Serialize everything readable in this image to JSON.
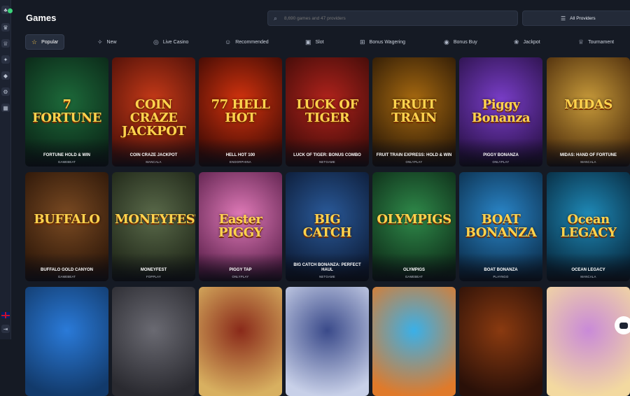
{
  "header": {
    "title": "Games",
    "search_placeholder": "8,690 games and 47 providers",
    "providers_label": "All Providers"
  },
  "tabs": [
    {
      "label": "Popular",
      "icon": "star-icon",
      "glyph": "☆"
    },
    {
      "label": "New",
      "icon": "tag-icon",
      "glyph": "✧"
    },
    {
      "label": "Live Casino",
      "icon": "chip-icon",
      "glyph": "◎"
    },
    {
      "label": "Recommended",
      "icon": "thumbs-up-icon",
      "glyph": "☺"
    },
    {
      "label": "Slot",
      "icon": "slot-machine-icon",
      "glyph": "▣"
    },
    {
      "label": "Bonus Wagering",
      "icon": "gift-icon",
      "glyph": "⊞"
    },
    {
      "label": "Bonus Buy",
      "icon": "coin-icon",
      "glyph": "◉"
    },
    {
      "label": "Jackpot",
      "icon": "jackpot-icon",
      "glyph": "❀"
    },
    {
      "label": "Tournament",
      "icon": "trophy-icon",
      "glyph": "♕"
    }
  ],
  "games": [
    {
      "name": "FORTUNE HOLD & WIN",
      "provider": "GAMEBEAT",
      "logo": "7 FORTUNE",
      "bg": "#1d6a3a",
      "bg2": "#0a2416"
    },
    {
      "name": "COIN CRAZE JACKPOT",
      "provider": "MANCALA",
      "logo": "COIN CRAZE JACKPOT",
      "bg": "#c73a18",
      "bg2": "#4a0f08"
    },
    {
      "name": "HELL HOT 100",
      "provider": "ENDORPHINA",
      "logo": "77 HELL HOT",
      "bg": "#d4330e",
      "bg2": "#3a0904"
    },
    {
      "name": "LUCK OF TIGER: BONUS COMBO",
      "provider": "NETGAME",
      "logo": "LUCK OF TIGER",
      "bg": "#b2231c",
      "bg2": "#3d0b08"
    },
    {
      "name": "FRUIT TRAIN EXPRESS: HOLD & WIN",
      "provider": "ONLYPLAY",
      "logo": "FRUIT TRAIN",
      "bg": "#a86a10",
      "bg2": "#2a1806"
    },
    {
      "name": "PIGGY BONANZA",
      "provider": "ONLYPLAY",
      "logo": "Piggy Bonanza",
      "bg": "#7a3ec9",
      "bg2": "#2a1148"
    },
    {
      "name": "MIDAS: HAND OF FORTUNE",
      "provider": "MANCALA",
      "logo": "MIDAS",
      "bg": "#c79a3a",
      "bg2": "#4b2b0b"
    },
    {
      "name": "BUFFALO GOLD CANYON",
      "provider": "GAMEBEAT",
      "logo": "BUFFALO",
      "bg": "#7a4a22",
      "bg2": "#2a1508"
    },
    {
      "name": "MONEYFEST",
      "provider": "FOPPLAY",
      "logo": "MONEYFEST",
      "bg": "#5a6a4a",
      "bg2": "#1d2416"
    },
    {
      "name": "PIGGY TAP",
      "provider": "ONLYPLAY",
      "logo": "Easter PIGGY",
      "bg": "#e07ab8",
      "bg2": "#5a1f4a"
    },
    {
      "name": "BIG CATCH BONANZA: PERFECT HAUL",
      "provider": "NETGAME",
      "logo": "BIG CATCH",
      "bg": "#2a5a9a",
      "bg2": "#0c1a34"
    },
    {
      "name": "OLYMPIGS",
      "provider": "GAMEBEAT",
      "logo": "OLYMPIGS",
      "bg": "#2f8a4a",
      "bg2": "#0d2a17"
    },
    {
      "name": "BOAT BONANZA",
      "provider": "PLAYNGO",
      "logo": "BOAT BONANZA",
      "bg": "#2a86c9",
      "bg2": "#0b2d4a"
    },
    {
      "name": "OCEAN LEGACY",
      "provider": "MANCALA",
      "logo": "Ocean LEGACY",
      "bg": "#1f8ab8",
      "bg2": "#07283d"
    },
    {
      "name": "",
      "provider": "",
      "logo": "",
      "bg": "#2a7ad8",
      "bg2": "#123a6b"
    },
    {
      "name": "",
      "provider": "",
      "logo": "",
      "bg": "#6a6a72",
      "bg2": "#2a2a30"
    },
    {
      "name": "",
      "provider": "",
      "logo": "",
      "bg": "#8a2a1a",
      "bg2": "#d8b060"
    },
    {
      "name": "",
      "provider": "",
      "logo": "",
      "bg": "#3a4a8a",
      "bg2": "#c8d0e8"
    },
    {
      "name": "",
      "provider": "",
      "logo": "",
      "bg": "#3ab0e8",
      "bg2": "#e07a2a"
    },
    {
      "name": "",
      "provider": "",
      "logo": "",
      "bg": "#8a3a10",
      "bg2": "#2a1008"
    },
    {
      "name": "",
      "provider": "",
      "logo": "",
      "bg": "#c98ad8",
      "bg2": "#f3d9a0"
    }
  ],
  "sidebar_icons": [
    "casino-icon",
    "crown-icon",
    "trophy-icon",
    "promo-icon",
    "ticket-icon",
    "settings-icon",
    "calendar-icon"
  ],
  "colors": {
    "accent": "#f2c14a",
    "background": "#151a24",
    "panel": "#232a38"
  }
}
